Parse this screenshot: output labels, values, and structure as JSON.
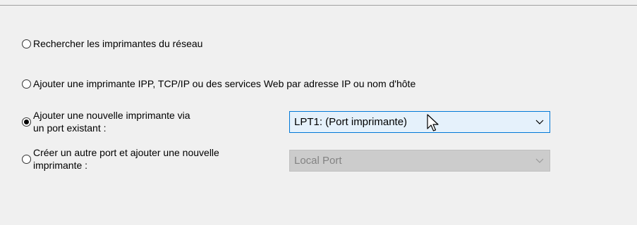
{
  "options": [
    {
      "label": "Rechercher les imprimantes du réseau",
      "checked": false
    },
    {
      "label": "Ajouter une imprimante IPP, TCP/IP ou des services Web par adresse IP ou nom d'hôte",
      "checked": false
    },
    {
      "label_line1": "Ajouter une nouvelle imprimante via",
      "label_line2": "un port existant :",
      "checked": true
    },
    {
      "label_line1": "Créer un autre port et ajouter une nouvelle",
      "label_line2": "imprimante :",
      "checked": false
    }
  ],
  "existing_port_select": {
    "value": "LPT1: (Port imprimante)",
    "enabled": true
  },
  "new_port_select": {
    "value": "Local Port",
    "enabled": false
  },
  "colors": {
    "accent": "#0078d7",
    "active_select_bg": "#e5f1fb",
    "disabled_select_bg": "#cccccc",
    "window_bg": "#f0f0f0"
  },
  "icons": {
    "dropdown": "chevron-down-icon",
    "pointer": "mouse-cursor-icon"
  }
}
